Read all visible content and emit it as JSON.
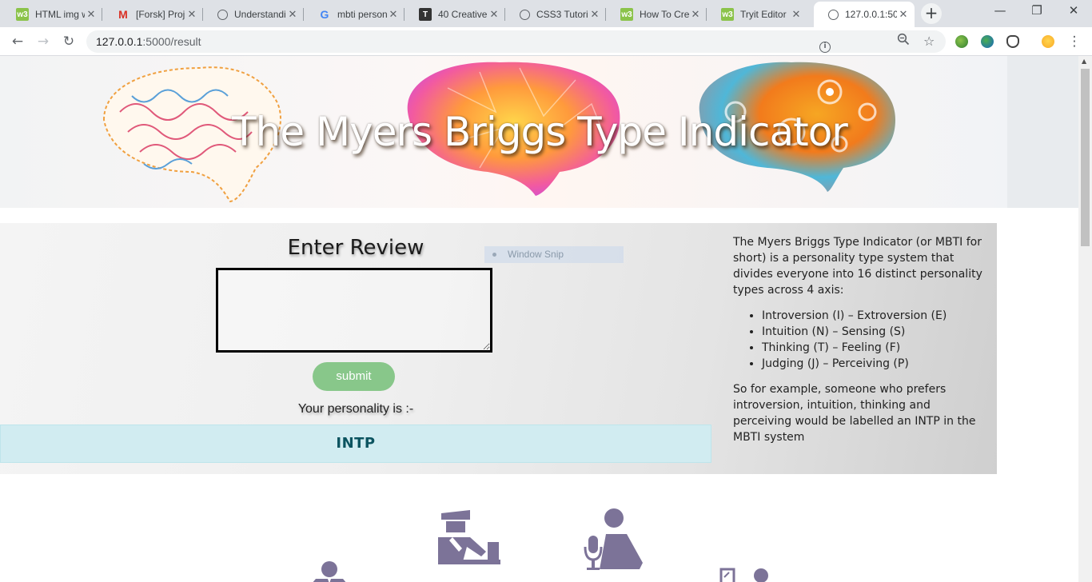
{
  "browser": {
    "tabs": [
      {
        "title": "HTML img w",
        "favicon": "w3schools-icon"
      },
      {
        "title": "[Forsk] Proj",
        "favicon": "gmail-icon"
      },
      {
        "title": "Understandi",
        "favicon": "globe-icon"
      },
      {
        "title": "mbti person",
        "favicon": "google-icon"
      },
      {
        "title": "40 Creative",
        "favicon": "t-icon"
      },
      {
        "title": "CSS3 Tutori",
        "favicon": "globe-icon"
      },
      {
        "title": "How To Cre",
        "favicon": "w3schools-icon"
      },
      {
        "title": "Tryit Editor",
        "favicon": "w3schools-icon"
      },
      {
        "title": "127.0.0.1:50",
        "favicon": "globe-icon",
        "active": true
      }
    ],
    "address": {
      "host": "127.0.0.1",
      "path": ":5000/result"
    }
  },
  "page": {
    "banner_title": "The Myers Briggs Type Indicator",
    "review_heading": "Enter Review",
    "review_value": "",
    "submit_label": "submit",
    "result_label": "Your personality is :-",
    "result_value": "INTP",
    "snip_label": "Window Snip",
    "info": {
      "intro": "The Myers Briggs Type Indicator (or MBTI for short) is a personality type system that divides everyone into 16 distinct personality types across 4 axis:",
      "axes": [
        "Introversion (I) – Extroversion (E)",
        "Intuition (N) – Sensing (S)",
        "Thinking (T) – Feeling (F)",
        "Judging (J) – Perceiving (P)"
      ],
      "example": "So for example, someone who prefers introversion, intuition, thinking and perceiving would be labelled an INTP in the MBTI system"
    },
    "icon_color": "#7c7398",
    "bottom_icons": [
      "businessman-icon",
      "police-officer-icon",
      "podcaster-icon",
      "presenter-icon"
    ]
  }
}
